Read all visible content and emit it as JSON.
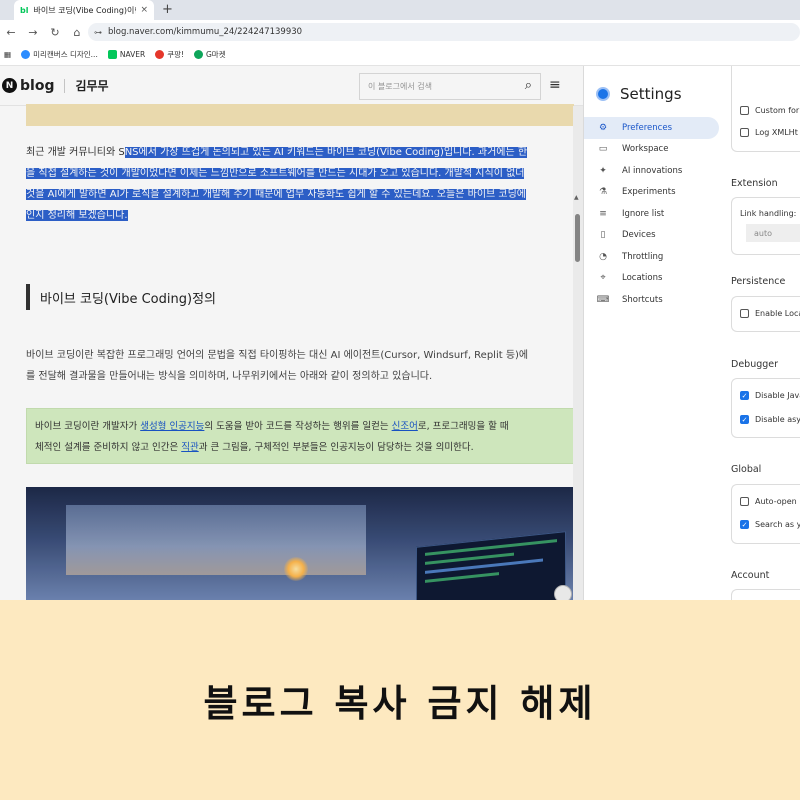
{
  "browser": {
    "tab_icon": "bl",
    "tab_title": "바이브 코딩(Vibe Coding)이란",
    "tab_close": "×",
    "new_tab": "+",
    "url": "blog.naver.com/kimmumu_24/224247139930",
    "bookmarks": [
      {
        "label": "미리캔버스 디자인...",
        "color": "#2b8cff"
      },
      {
        "label": "NAVER",
        "color": "#03c75a"
      },
      {
        "label": "쿠팡!",
        "color": "#e5372b"
      },
      {
        "label": "G마켓",
        "color": "#0ea55a"
      }
    ]
  },
  "blog": {
    "logo_letter": "N",
    "logo_text": "blog",
    "owner": "김무무",
    "search_placeholder": "이 블로그에서 검색",
    "intro_lines": [
      {
        "plain": "최근 개발 커뮤니티와 S",
        "highlighted": "NS에서 가장 뜨겁게 논의되고 있는 AI 키워드는 바이브 코딩(Vibe Coding)입니다. 과거에는 한"
      },
      {
        "plain": "",
        "highlighted": "을 직접 설계하는 것이 개발이었다면 이제는 느낌만으로 소프트웨어를 만드는 시대가 오고 있습니다. 개발적 지식이 없더"
      },
      {
        "plain": "",
        "highlighted": "것을 AI에게 말하면 AI가 로직을 설계하고 개발해 주기 때문에 업무 자동화도 쉽게 할 수 있는데요. 오늘은 바이브 코딩에"
      },
      {
        "plain": "",
        "highlighted": "인지 정리해 보겠습니다."
      }
    ],
    "section_title": "바이브 코딩(Vibe Coding)정의",
    "paragraph_lines": [
      "바이브 코딩이란 복잡한 프로그래밍 언어의 문법을 직접 타이핑하는 대신 AI 에이전트(Cursor, Windsurf, Replit 등)에",
      "를 전달해 결과물을 만들어내는 방식을 의미하며, 나무위키에서는 아래와 같이 정의하고 있습니다."
    ],
    "quote": {
      "l1_a": "바이브 코딩이란 개발자가 ",
      "l1_link1": "생성형 인공지능",
      "l1_b": "의 도움을 받아 코드를 작성하는 행위를 일컫는 ",
      "l1_link2": "신조어",
      "l1_c": "로, 프로그래밍을 할 때",
      "l2_a": "체적인 설계를 준비하지 않고 인간은 ",
      "l2_link": "직관",
      "l2_b": "과 큰 그림을, 구체적인 부분들은 인공지능이 담당하는 것을 의미한다."
    }
  },
  "settings": {
    "title": "Settings",
    "nav": [
      {
        "label": "Preferences",
        "icon": "gear-icon",
        "glyph": "⚙",
        "active": true
      },
      {
        "label": "Workspace",
        "icon": "folder-icon",
        "glyph": "▭",
        "active": false
      },
      {
        "label": "AI innovations",
        "icon": "sparkle-icon",
        "glyph": "✦",
        "active": false
      },
      {
        "label": "Experiments",
        "icon": "flask-icon",
        "glyph": "⚗",
        "active": false
      },
      {
        "label": "Ignore list",
        "icon": "ignore-list-icon",
        "glyph": "≡",
        "active": false
      },
      {
        "label": "Devices",
        "icon": "devices-icon",
        "glyph": "▯",
        "active": false
      },
      {
        "label": "Throttling",
        "icon": "gauge-icon",
        "glyph": "◔",
        "active": false
      },
      {
        "label": "Locations",
        "icon": "location-pin-icon",
        "glyph": "⌖",
        "active": false
      },
      {
        "label": "Shortcuts",
        "icon": "keyboard-icon",
        "glyph": "⌨",
        "active": false
      }
    ],
    "network": {
      "custom_for": "Custom for",
      "log_xmlhttp": "Log XMLHt"
    },
    "extension": {
      "title": "Extension",
      "link_handling": "Link handling:",
      "select_value": "auto"
    },
    "persistence": {
      "title": "Persistence",
      "enable_local": "Enable Loca"
    },
    "debugger": {
      "title": "Debugger",
      "disable_java": "Disable Java",
      "disable_async": "Disable asy"
    },
    "global": {
      "title": "Global",
      "auto_open": "Auto-open",
      "search_as_you": "Search as y"
    },
    "account": {
      "title": "Account"
    }
  },
  "banner": {
    "text": "블로그 복사 금지 해제",
    "background": "#fde9c0"
  }
}
